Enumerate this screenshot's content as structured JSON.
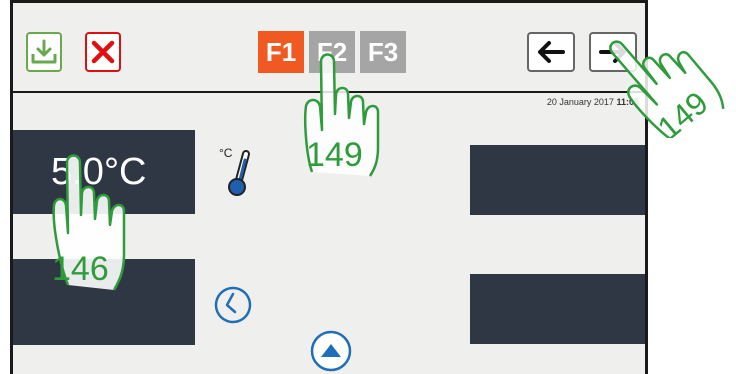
{
  "toolbar": {
    "save_icon": "download-save-icon",
    "cancel_icon": "close-x-icon",
    "back_icon": "arrow-left-icon",
    "forward_icon": "arrow-right-icon"
  },
  "tabs": [
    {
      "label": "F1",
      "active": true
    },
    {
      "label": "F2",
      "active": false
    },
    {
      "label": "F3",
      "active": false
    }
  ],
  "status": {
    "date": "20 January 2017",
    "time": "11:05"
  },
  "fields": {
    "temperature_value": "5.0°C"
  },
  "icons": {
    "temperature_unit": "°C",
    "thermometer": "thermometer-icon",
    "clock": "clock-icon",
    "scroll_up": "up-triangle-icon"
  },
  "callouts": [
    {
      "number": "146",
      "target": "temperature field"
    },
    {
      "number": "149",
      "target": "F2 tab"
    },
    {
      "number": "149",
      "target": "forward arrow"
    }
  ],
  "colors": {
    "accent_orange": "#f05a22",
    "tab_inactive": "#a5a5a5",
    "save_green": "#6aa84f",
    "cancel_red": "#e01010",
    "field_dark": "#2f3744",
    "clock_blue": "#1f6fb8",
    "callout_green": "#2e9c3a"
  }
}
